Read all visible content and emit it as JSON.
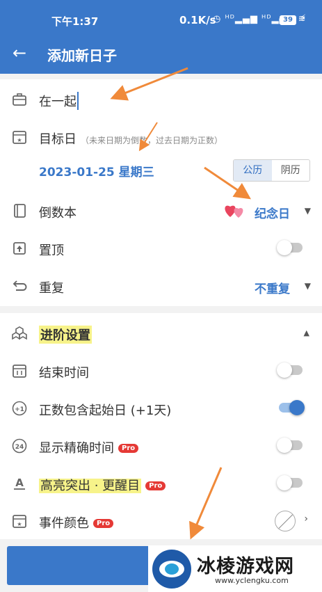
{
  "status_bar": {
    "time": "下午1:37",
    "net_speed": "0.1K/s",
    "battery": "39",
    "signal_icons": "◷ ᴴᴰ▂▄▆ ᴴᴰ▂▄▆ ≋"
  },
  "app_bar": {
    "title": "添加新日子",
    "back_icon": "back-arrow-icon"
  },
  "form": {
    "title_value": "在一起",
    "target_date": {
      "label": "目标日",
      "hint": "（未来日期为倒数，过去日期为正数）",
      "value": "2023-01-25 星期三",
      "calendar_options": [
        "公历",
        "阴历"
      ],
      "calendar_selected": "公历"
    },
    "book": {
      "label": "倒数本",
      "value": "纪念日"
    },
    "pin_top": {
      "label": "置顶",
      "enabled": false
    },
    "repeat": {
      "label": "重复",
      "value": "不重复"
    }
  },
  "advanced": {
    "header": "进阶设置",
    "end_time": {
      "label": "结束时间",
      "enabled": false
    },
    "include_start": {
      "label": "正数包含起始日 (+1天)",
      "enabled": true
    },
    "precise_time": {
      "label": "显示精确时间",
      "badge": "Pro",
      "enabled": false
    },
    "highlight": {
      "label": "高亮突出 · 更醒目",
      "badge": "Pro",
      "enabled": false
    },
    "event_color": {
      "label": "事件颜色",
      "badge": "Pro"
    }
  },
  "watermark": {
    "name": "冰棱游戏网",
    "url": "www.yclengku.com"
  },
  "colors": {
    "primary": "#3a78c9",
    "annotation_arrow": "#f08a3a",
    "pro_badge": "#e53935",
    "highlight": "#f7f38a"
  }
}
